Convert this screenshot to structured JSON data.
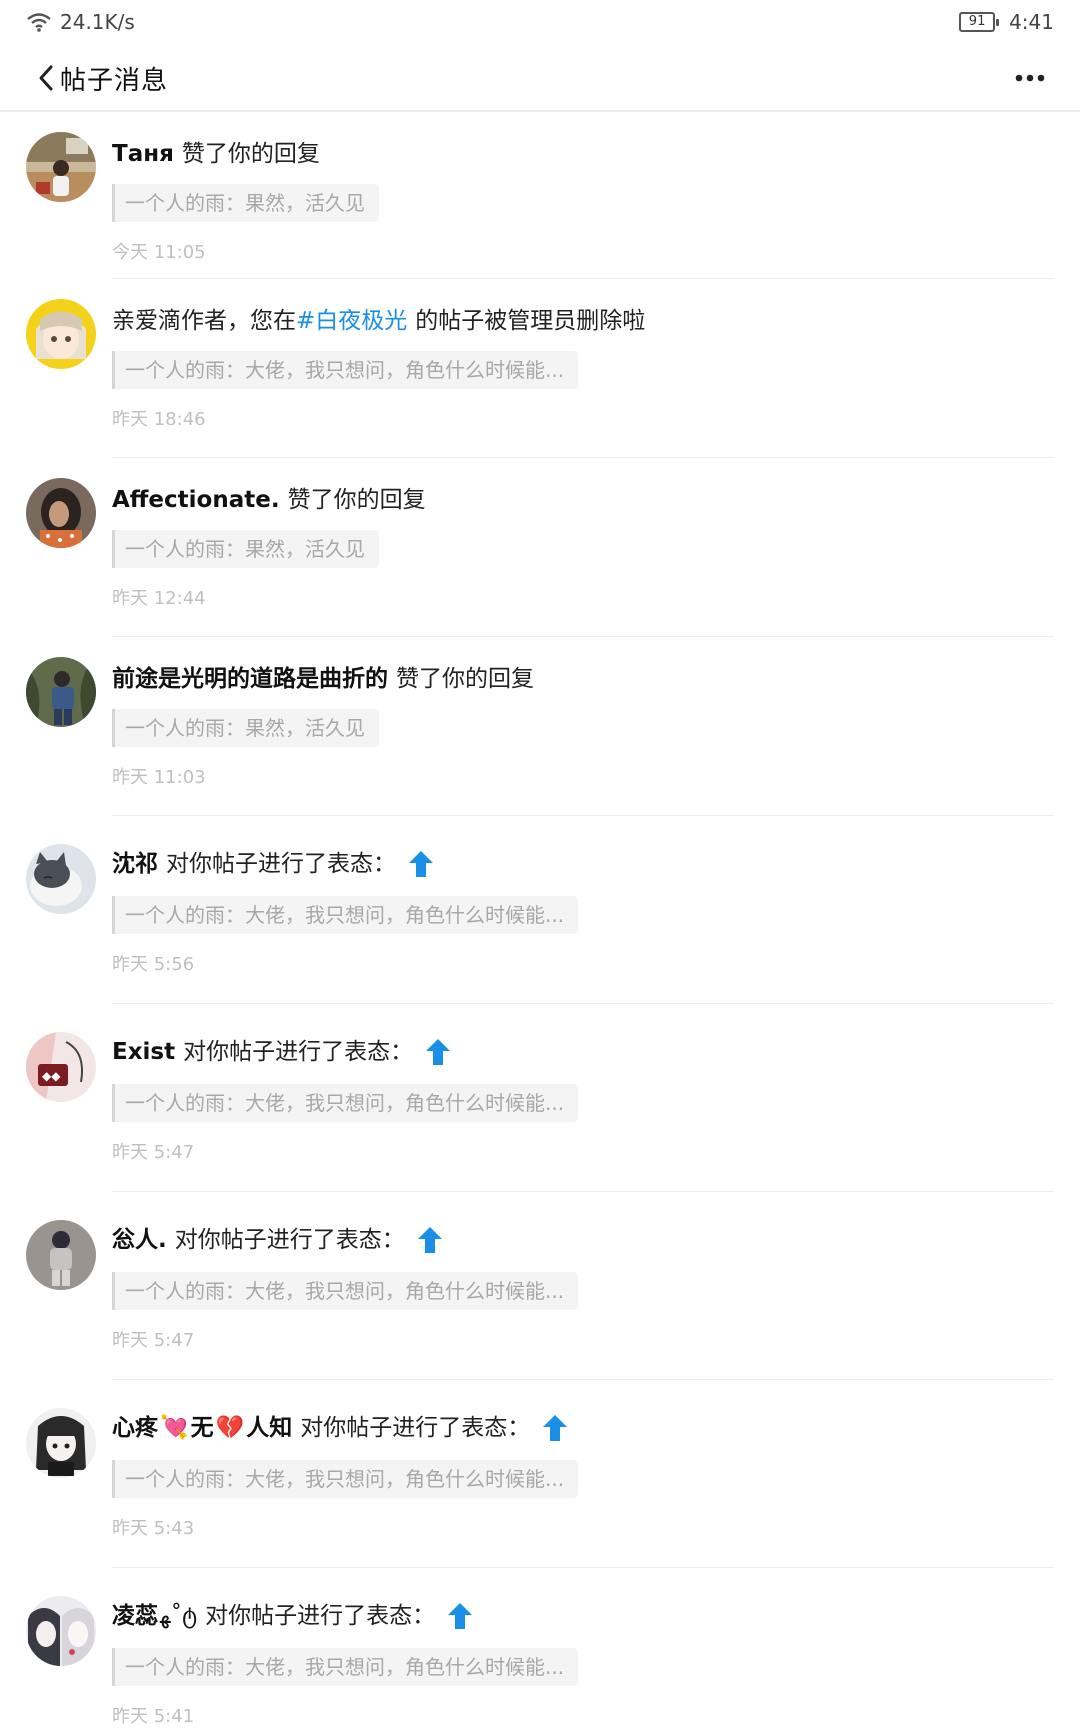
{
  "status": {
    "net_speed": "24.1K/s",
    "battery": "91",
    "time": "4:41"
  },
  "header": {
    "title": "帖子消息"
  },
  "messages": [
    {
      "user": "Таня",
      "action": "赞了你的回复",
      "quote": "一个人的雨：果然，活久见",
      "time": "今天 11:05"
    },
    {
      "prefix": "亲爱滴作者，您在",
      "tag": "#白夜极光",
      "action": "的帖子被管理员删除啦",
      "quote": "一个人的雨：大佬，我只想问，角色什么时候能...",
      "time": "昨天 18:46"
    },
    {
      "user": "Affectionate.",
      "action": "赞了你的回复",
      "quote": "一个人的雨：果然，活久见",
      "time": "昨天 12:44"
    },
    {
      "user": "前途是光明的道路是曲折的",
      "action": "赞了你的回复",
      "quote": "一个人的雨：果然，活久见",
      "time": "昨天 11:03"
    },
    {
      "user": "沈祁",
      "action": "对你帖子进行了表态：",
      "quote": "一个人的雨：大佬，我只想问，角色什么时候能...",
      "time": "昨天 5:56"
    },
    {
      "user": "Exist",
      "action": "对你帖子进行了表态：",
      "quote": "一个人的雨：大佬，我只想问，角色什么时候能...",
      "time": "昨天 5:47"
    },
    {
      "user": "忩人.",
      "action": "对你帖子进行了表态：",
      "quote": "一个人的雨：大佬，我只想问，角色什么时候能...",
      "time": "昨天 5:47"
    },
    {
      "user_part1": "心疼",
      "user_part2": "无",
      "user_part3": "人知",
      "emoji1": "💘",
      "emoji2": "💔",
      "action": "对你帖子进行了表态：",
      "quote": "一个人的雨：大佬，我只想问，角色什么时候能...",
      "time": "昨天 5:43"
    },
    {
      "user": "凌蕊",
      "user_suffix": "ﻬ˚ტ",
      "action": "对你帖子进行了表态：",
      "quote": "一个人的雨：大佬，我只想问，角色什么时候能...",
      "time": "昨天 5:41"
    }
  ],
  "colors": {
    "tag": "#1a8fe8",
    "upvote": "#1a8fe8",
    "time": "#c0c0c0",
    "quote_bg": "#f4f4f4"
  }
}
